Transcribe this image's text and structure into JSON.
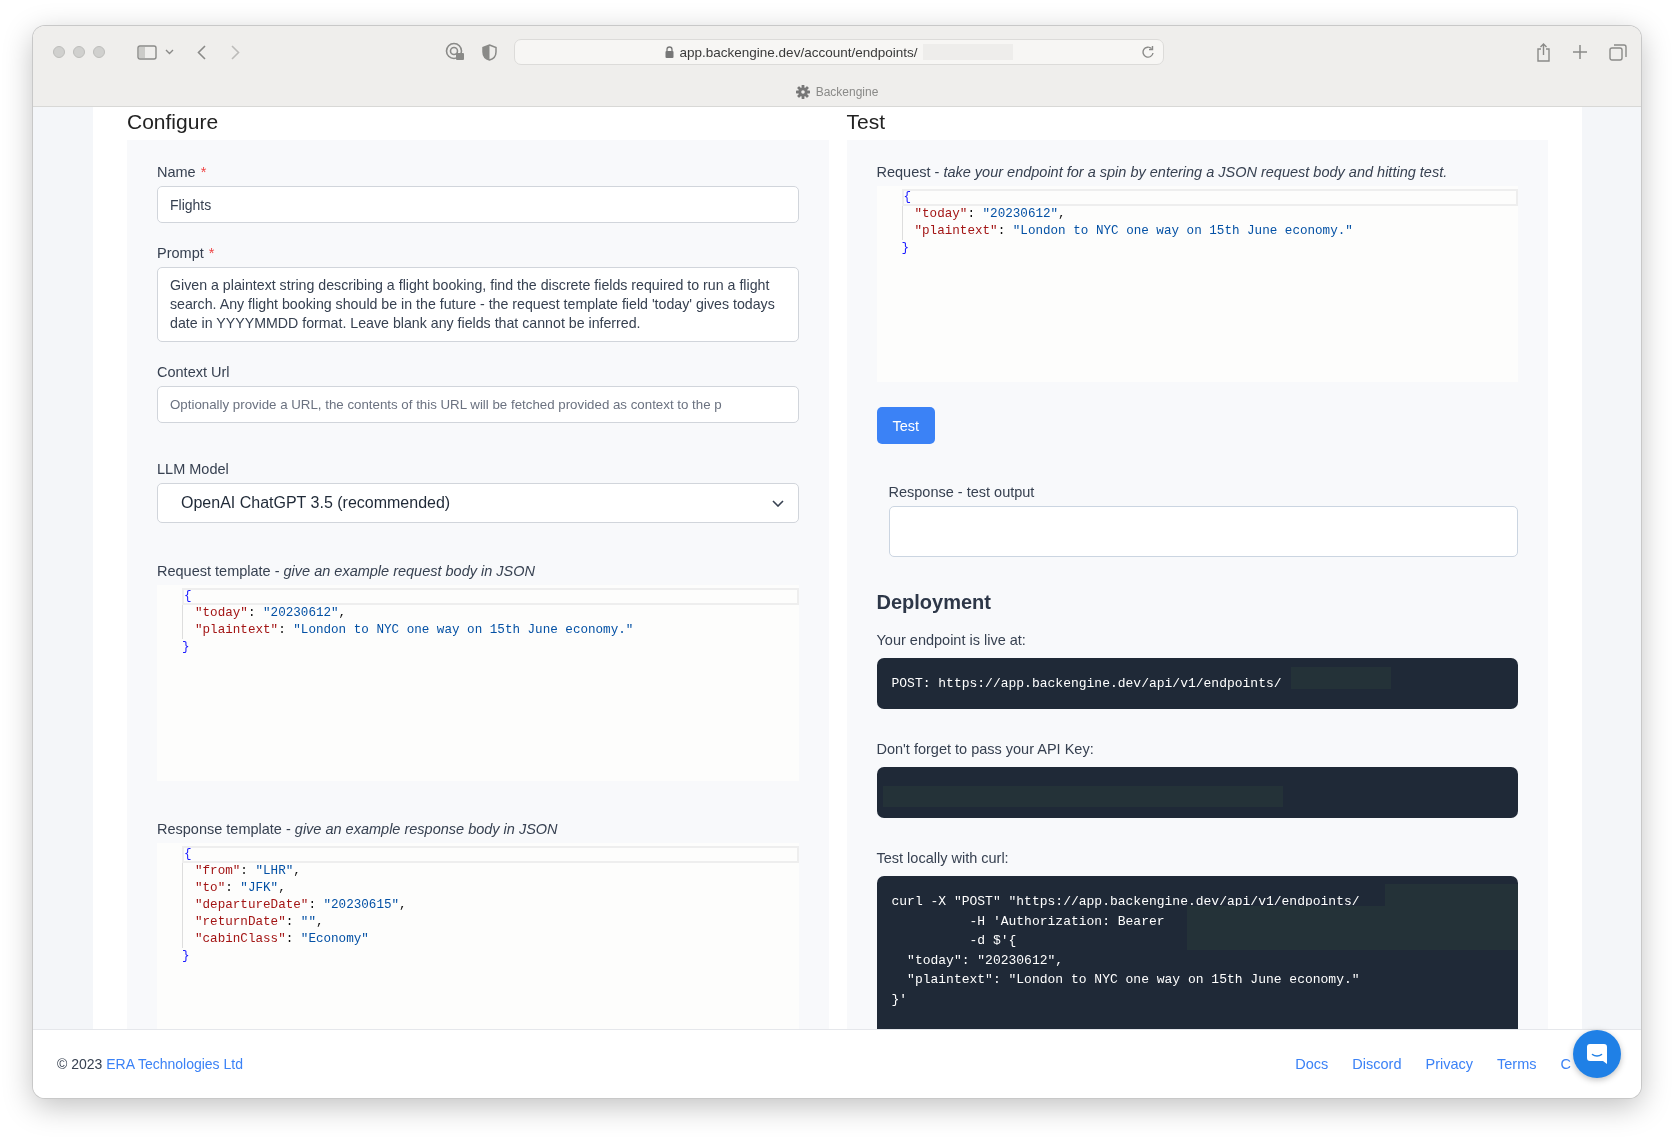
{
  "browser": {
    "url": "app.backengine.dev/account/endpoints/",
    "url_redacted": true,
    "tab_title": "Backengine"
  },
  "configure": {
    "heading": "Configure",
    "name": {
      "label": "Name",
      "required_mark": "*",
      "value": "Flights"
    },
    "prompt": {
      "label": "Prompt",
      "required_mark": "*",
      "value": "Given a plaintext string describing a flight booking, find the discrete fields required to run a flight search. Any flight booking should be in the future - the request template field 'today' gives todays date in YYYYMMDD format. Leave blank any fields that cannot be inferred."
    },
    "context_url": {
      "label": "Context Url",
      "placeholder": "Optionally provide a URL, the contents of this URL will be fetched provided as context to the p"
    },
    "llm_model": {
      "label": "LLM Model",
      "value": "OpenAI ChatGPT 3.5 (recommended)"
    },
    "request_template": {
      "label": "Request template - *give an example request body in JSON*",
      "lines": [
        {
          "kind": "open",
          "active": true,
          "tokens": [
            {
              "t": "{",
              "kind": "brace"
            }
          ]
        },
        {
          "kind": "member",
          "active": false,
          "tokens": [
            {
              "t": "\"today\"",
              "kind": "key"
            },
            {
              "t": ": ",
              "kind": "punct"
            },
            {
              "t": "\"20230612\"",
              "kind": "string"
            },
            {
              "t": ",",
              "kind": "punct"
            }
          ]
        },
        {
          "kind": "member",
          "active": false,
          "tokens": [
            {
              "t": "\"plaintext\"",
              "kind": "key"
            },
            {
              "t": ": ",
              "kind": "punct"
            },
            {
              "t": "\"London to NYC one way on 15th June economy.\"",
              "kind": "string"
            }
          ]
        },
        {
          "kind": "close",
          "active": false,
          "tokens": [
            {
              "t": "}",
              "kind": "brace"
            }
          ]
        }
      ]
    },
    "response_template": {
      "label": "Response template - *give an example response body in JSON*",
      "lines": [
        {
          "kind": "open",
          "active": true,
          "tokens": [
            {
              "t": "{",
              "kind": "brace"
            }
          ]
        },
        {
          "kind": "member",
          "active": false,
          "tokens": [
            {
              "t": "\"from\"",
              "kind": "key"
            },
            {
              "t": ": ",
              "kind": "punct"
            },
            {
              "t": "\"LHR\"",
              "kind": "string"
            },
            {
              "t": ",",
              "kind": "punct"
            }
          ]
        },
        {
          "kind": "member",
          "active": false,
          "tokens": [
            {
              "t": "\"to\"",
              "kind": "key"
            },
            {
              "t": ": ",
              "kind": "punct"
            },
            {
              "t": "\"JFK\"",
              "kind": "string"
            },
            {
              "t": ",",
              "kind": "punct"
            }
          ]
        },
        {
          "kind": "member",
          "active": false,
          "tokens": [
            {
              "t": "\"departureDate\"",
              "kind": "key"
            },
            {
              "t": ": ",
              "kind": "punct"
            },
            {
              "t": "\"20230615\"",
              "kind": "string"
            },
            {
              "t": ",",
              "kind": "punct"
            }
          ]
        },
        {
          "kind": "member",
          "active": false,
          "tokens": [
            {
              "t": "\"returnDate\"",
              "kind": "key"
            },
            {
              "t": ": ",
              "kind": "punct"
            },
            {
              "t": "\"\"",
              "kind": "string"
            },
            {
              "t": ",",
              "kind": "punct"
            }
          ]
        },
        {
          "kind": "member",
          "active": false,
          "tokens": [
            {
              "t": "\"cabinClass\"",
              "kind": "key"
            },
            {
              "t": ": ",
              "kind": "punct"
            },
            {
              "t": "\"Economy\"",
              "kind": "string"
            }
          ]
        },
        {
          "kind": "close",
          "active": false,
          "tokens": [
            {
              "t": "}",
              "kind": "brace"
            }
          ]
        }
      ]
    }
  },
  "test": {
    "heading": "Test",
    "request": {
      "label": "Request - *take your endpoint for a spin by entering a JSON request body and hitting test.*",
      "lines": [
        {
          "kind": "open",
          "active": true,
          "tokens": [
            {
              "t": "{",
              "kind": "brace"
            }
          ]
        },
        {
          "kind": "member",
          "active": false,
          "tokens": [
            {
              "t": "\"today\"",
              "kind": "key"
            },
            {
              "t": ": ",
              "kind": "punct"
            },
            {
              "t": "\"20230612\"",
              "kind": "string"
            },
            {
              "t": ",",
              "kind": "punct"
            }
          ]
        },
        {
          "kind": "member",
          "active": false,
          "tokens": [
            {
              "t": "\"plaintext\"",
              "kind": "key"
            },
            {
              "t": ": ",
              "kind": "punct"
            },
            {
              "t": "\"London to NYC one way on 15th June economy.\"",
              "kind": "string"
            }
          ]
        },
        {
          "kind": "close",
          "active": false,
          "tokens": [
            {
              "t": "}",
              "kind": "brace"
            }
          ]
        }
      ]
    },
    "button": "Test",
    "response": {
      "label": "Response - test output"
    }
  },
  "deployment": {
    "heading": "Deployment",
    "endpoint": {
      "label": "Your endpoint is live at:",
      "code": "POST: https://app.backengine.dev/api/v1/endpoints/",
      "redacted": true
    },
    "api_key": {
      "label": "Don't forget to pass your API Key:",
      "redacted": true
    },
    "curl": {
      "label": "Test locally with curl:",
      "redacted": true,
      "lines": [
        "curl -X \"POST\" \"https://app.backengine.dev/api/v1/endpoints/",
        "          -H 'Authorization: Bearer",
        "          -d $'{",
        "  \"today\": \"20230612\",",
        "  \"plaintext\": \"London to NYC one way on 15th June economy.\"",
        "}'"
      ]
    }
  },
  "footer": {
    "copyright": "© 2023 ",
    "company": "ERA Technologies Ltd",
    "links": [
      "Docs",
      "Discord",
      "Privacy",
      "Terms",
      "C"
    ]
  }
}
